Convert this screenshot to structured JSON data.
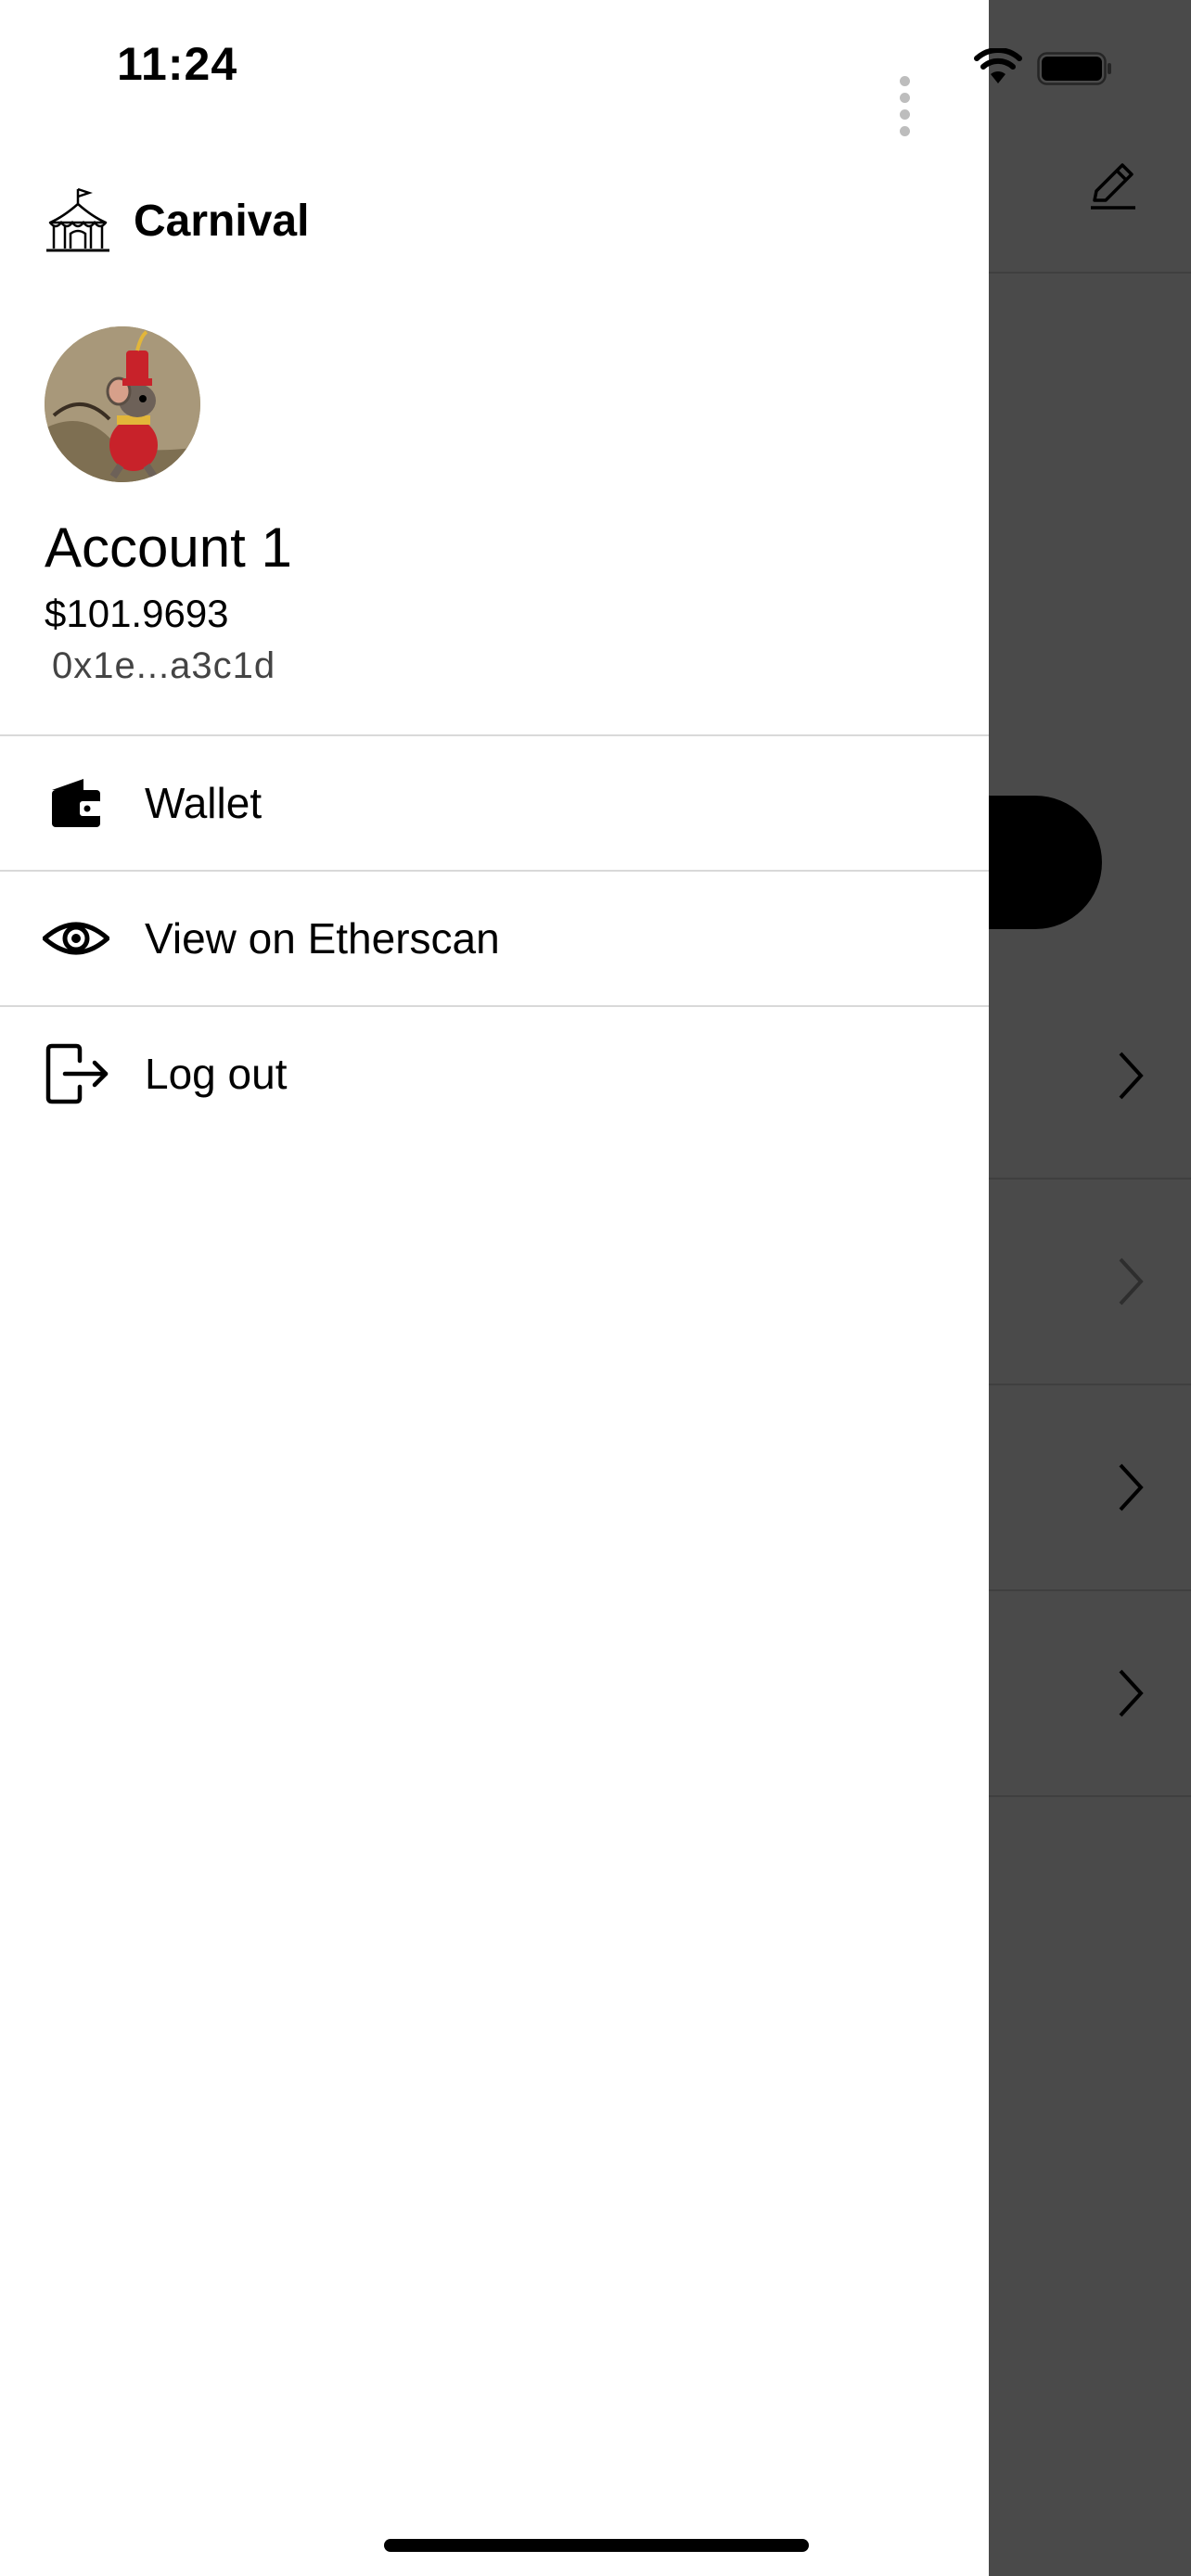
{
  "status_bar": {
    "time": "11:24"
  },
  "brand": {
    "name": "Carnival",
    "icon": "circus-tent-icon"
  },
  "account": {
    "name": "Account 1",
    "balance": "$101.9693",
    "address": "0x1e...a3c1d",
    "avatar": "mouse-avatar"
  },
  "menu": {
    "items": [
      {
        "label": "Wallet",
        "icon": "wallet-icon"
      },
      {
        "label": "View on Etherscan",
        "icon": "eye-icon"
      },
      {
        "label": "Log out",
        "icon": "logout-icon"
      }
    ]
  },
  "colors": {
    "drawer_background": "#ffffff",
    "overlay": "#4a4a4a",
    "divider": "#d9d9d9"
  }
}
